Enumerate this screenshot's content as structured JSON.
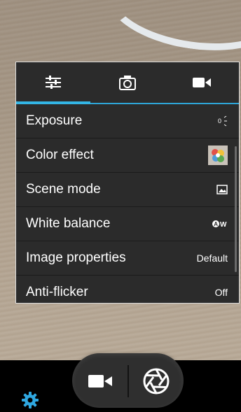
{
  "tabs": [
    {
      "icon": "sliders-icon"
    },
    {
      "icon": "camera-icon"
    },
    {
      "icon": "video-icon"
    }
  ],
  "settings": [
    {
      "label": "Exposure",
      "value": "",
      "icon": "exposure-icon"
    },
    {
      "label": "Color effect",
      "value": "",
      "icon": "color-effect-thumbnail-icon"
    },
    {
      "label": "Scene mode",
      "value": "",
      "icon": "scene-mode-icon"
    },
    {
      "label": "White balance",
      "value": "",
      "icon": "auto-white-balance-icon"
    },
    {
      "label": "Image properties",
      "value": "Default"
    },
    {
      "label": "Anti-flicker",
      "value": "Off"
    }
  ],
  "controls": {
    "video_icon": "video-record-icon",
    "shutter_icon": "shutter-icon",
    "settings_icon": "gear-icon"
  },
  "colors": {
    "accent": "#33b5e5",
    "panel_bg": "#2b2b2b",
    "gear": "#2fa7e0"
  }
}
